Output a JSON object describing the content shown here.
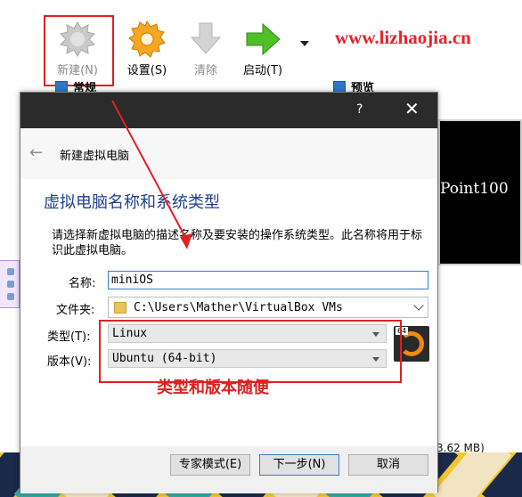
{
  "toolbar": {
    "new_label": "新建(N)",
    "settings_label": "设置(S)",
    "discard_label": "清除",
    "start_label": "启动(T)"
  },
  "watermark": "www.lizhaojia.cn",
  "sections": {
    "general": "常规",
    "preview": "预览"
  },
  "preview_text": "Point100",
  "size_text": "3.62 MB)",
  "dialog": {
    "help": "?",
    "close": "✕",
    "nav_title": "新建虚拟电脑",
    "heading": "虚拟电脑名称和系统类型",
    "description": "请选择新虚拟电脑的描述名称及要安装的操作系统类型。此名称将用于标识此虚拟电脑。",
    "name_label": "名称:",
    "name_value": "miniOS",
    "folder_label": "文件夹:",
    "folder_value": "C:\\Users\\Mather\\VirtualBox VMs",
    "type_label": "类型(T):",
    "type_value": "Linux",
    "version_label": "版本(V):",
    "version_value": "Ubuntu (64-bit)",
    "os_badge": "64",
    "annotation": "类型和版本随便",
    "buttons": {
      "expert": "专家模式(E)",
      "next": "下一步(N)",
      "cancel": "取消"
    }
  },
  "colors": {
    "accent_red": "#e02020",
    "heading_blue": "#1f3f8f",
    "titlebar": "#2b2b2b"
  }
}
